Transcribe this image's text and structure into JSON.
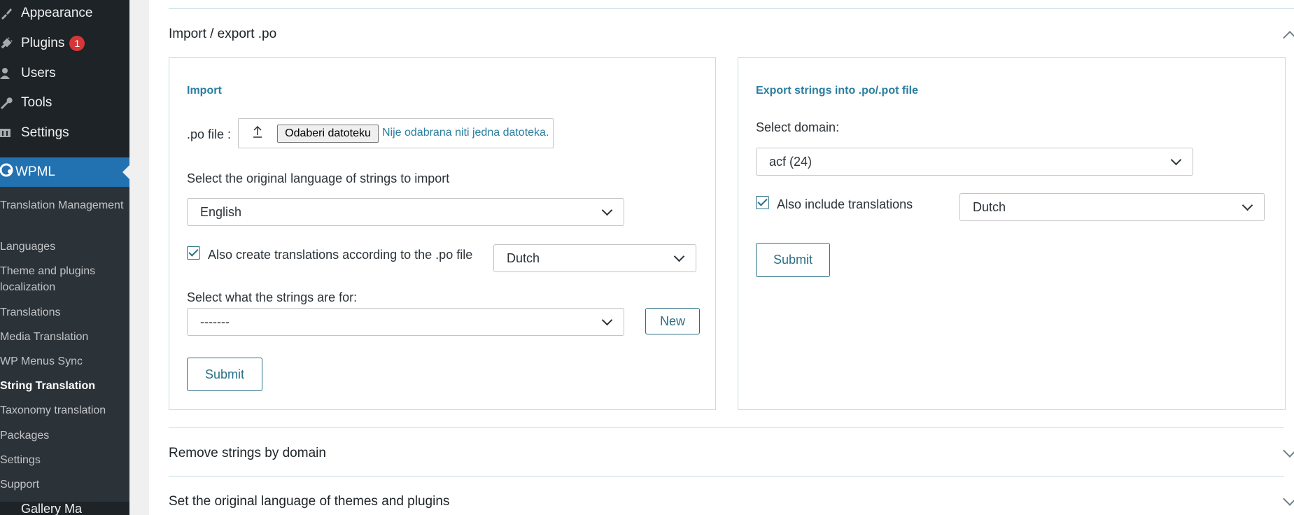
{
  "sidebar": {
    "top_items": [
      {
        "label": "Appearance",
        "icon": "paintbrush-icon"
      },
      {
        "label": "Plugins",
        "icon": "plugin-icon",
        "badge": "1"
      },
      {
        "label": "Users",
        "icon": "user-icon"
      },
      {
        "label": "Tools",
        "icon": "wrench-icon"
      },
      {
        "label": "Settings",
        "icon": "settings-icon"
      }
    ],
    "wpml_label": "WPML",
    "sub_items": [
      "Translation Management",
      "Languages",
      "Theme and plugins localization",
      "Translations",
      "Media Translation",
      "WP Menus Sync",
      "String Translation",
      "Taxonomy translation",
      "Packages",
      "Settings",
      "Support"
    ],
    "current_sub": "String Translation",
    "collapsed_next": "Gallery Ma"
  },
  "sections": {
    "import_export_title": "Import / export .po",
    "remove_title": "Remove strings by domain",
    "original_lang_title": "Set the original language of themes and plugins"
  },
  "import": {
    "title": "Import",
    "po_file_label": ".po file :",
    "file_button": "Odaberi datoteku",
    "file_status": "Nije odabrana niti jedna datoteka.",
    "orig_lang_label": "Select the original language of strings to import",
    "orig_lang_value": "English",
    "create_translations_label": "Also create translations according to the .po file",
    "translation_lang_value": "Dutch",
    "strings_for_label": "Select what the strings are for:",
    "strings_for_value": "-------",
    "new_button": "New",
    "submit": "Submit"
  },
  "export": {
    "title": "Export strings into .po/.pot file",
    "domain_label": "Select domain:",
    "domain_value": "acf (24)",
    "include_translations_label": "Also include translations",
    "include_lang_value": "Dutch",
    "submit": "Submit"
  }
}
